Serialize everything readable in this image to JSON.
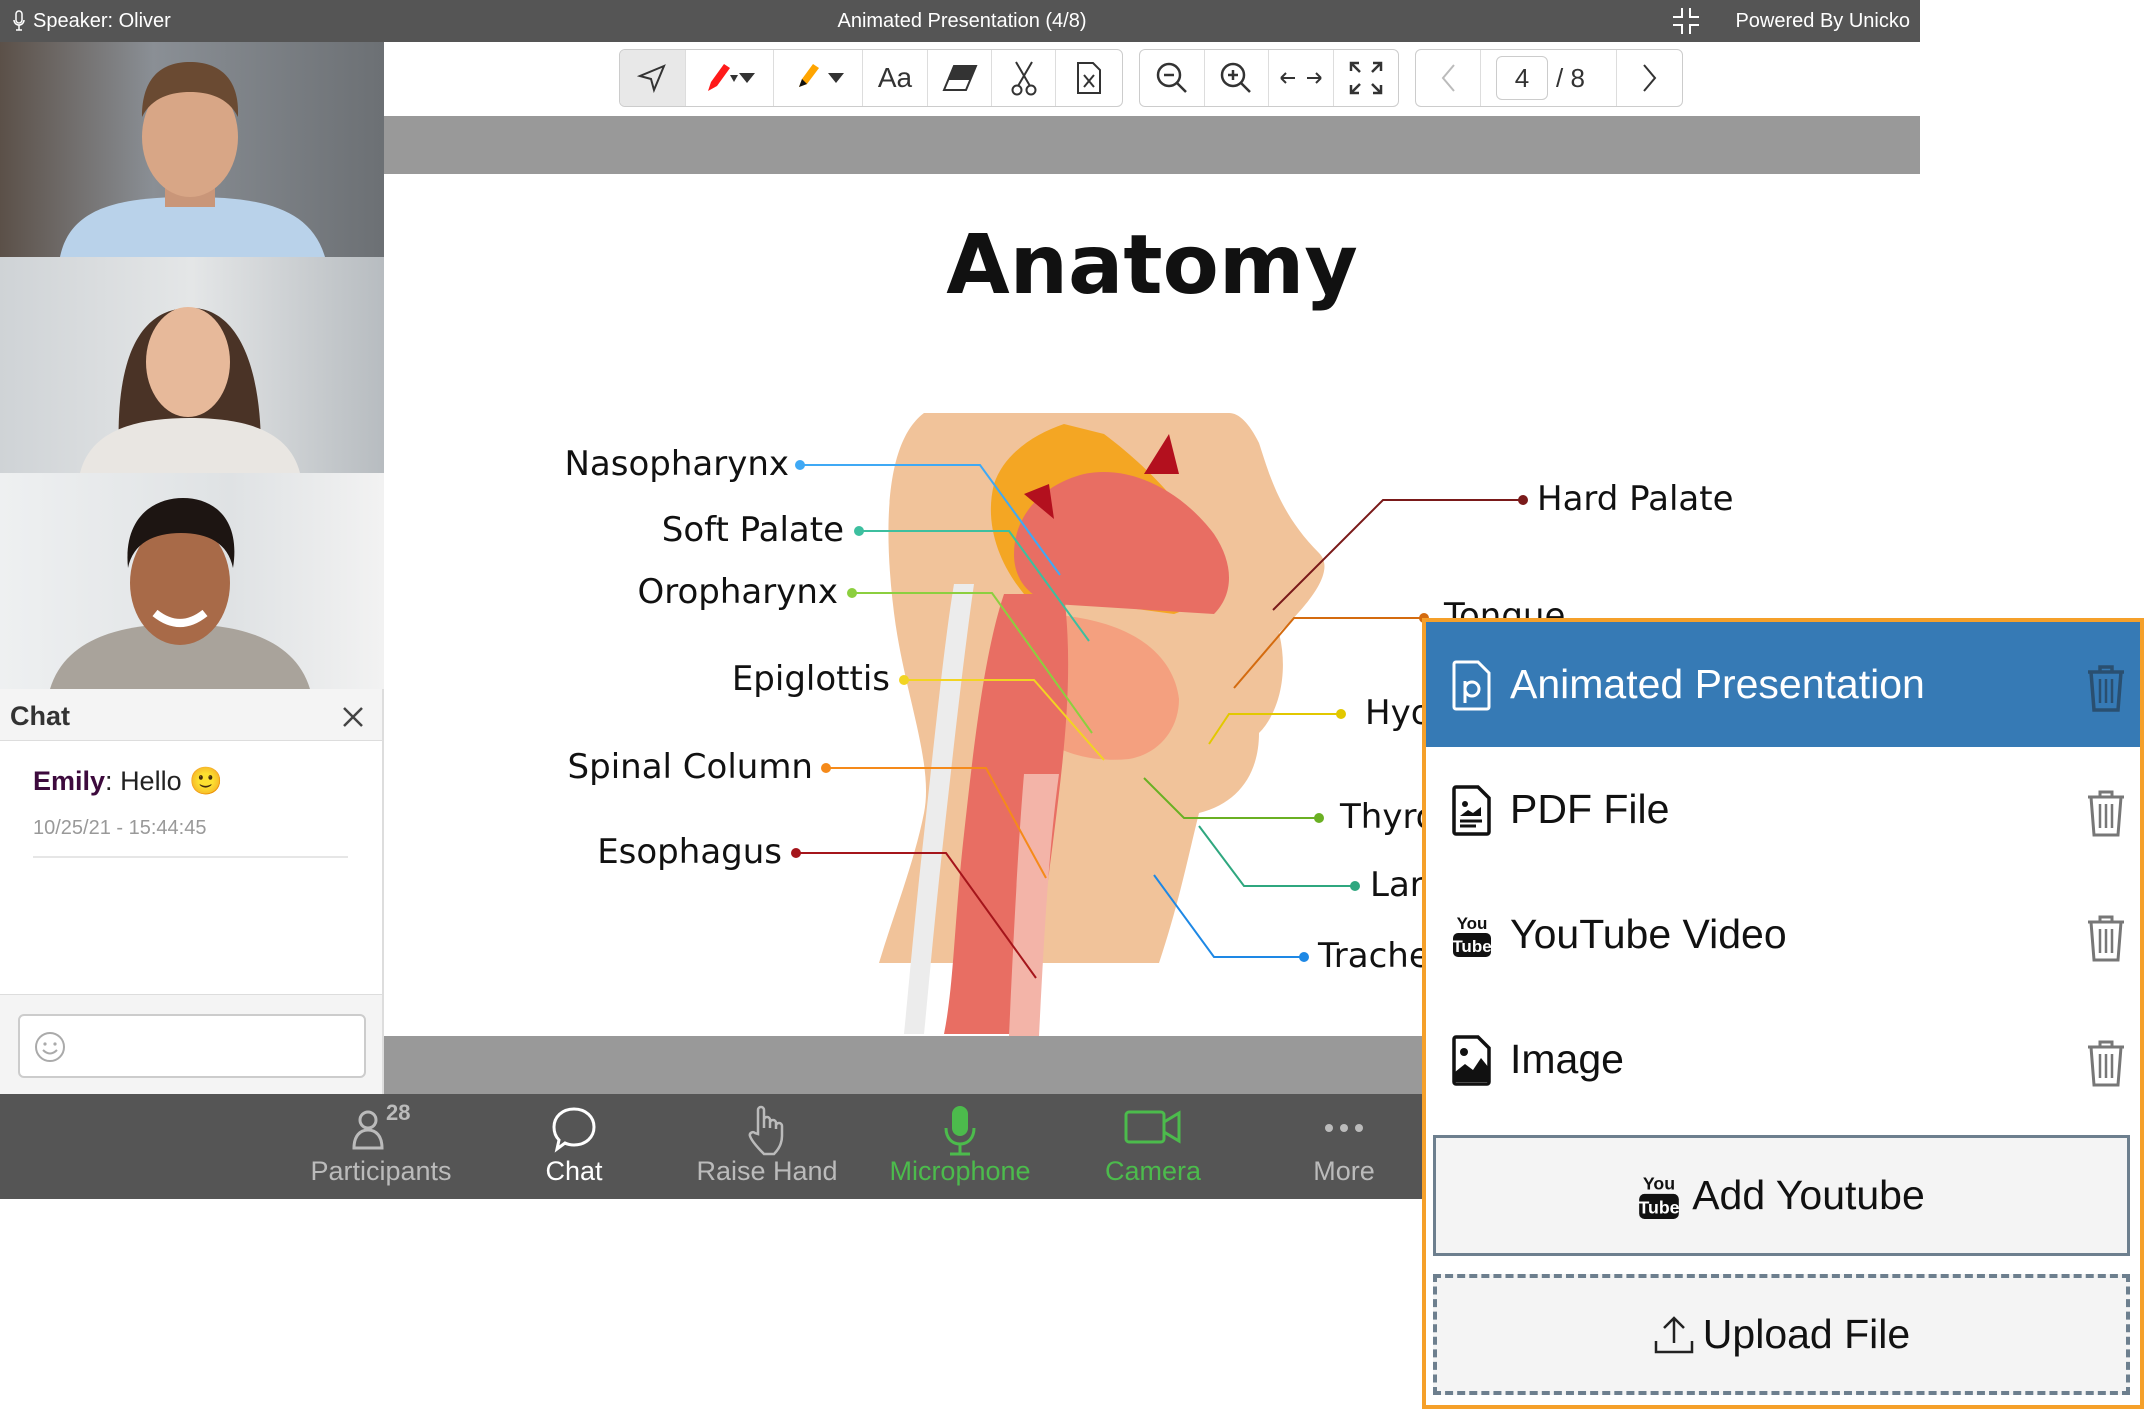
{
  "topbar": {
    "speaker": "Speaker: Oliver",
    "title": "Animated Presentation (4/8)",
    "powered": "Powered By Unicko"
  },
  "toolbar": {
    "page_current": "4",
    "page_total": "/ 8",
    "text_tool": "Aa",
    "pen_color": "#ff1a1a",
    "highlighter_color": "#ffa500"
  },
  "chat": {
    "title": "Chat",
    "messages": [
      {
        "author": "Emily",
        "separator": ": ",
        "text": "Hello",
        "emoji": "🙂",
        "timestamp": "10/25/21 - 15:44:45"
      }
    ],
    "input_placeholder": ""
  },
  "slide": {
    "title": "Anatomy",
    "labels_left": [
      "Nasopharynx",
      "Soft Palate",
      "Oropharynx",
      "Epiglottis",
      "Spinal Column",
      "Esophagus"
    ],
    "labels_right": [
      "Hard Palate",
      "Tongue",
      "Hyoid",
      "Thyroid",
      "Larynx",
      "Trachea"
    ]
  },
  "bottombar": {
    "participants_count": "28",
    "items": [
      "Participants",
      "Chat",
      "Raise Hand",
      "Microphone",
      "Camera",
      "More"
    ],
    "active_color": "#4cbb4c"
  },
  "panel": {
    "items": [
      {
        "label": "Animated Presentation",
        "icon": "presentation-file-icon",
        "selected": true
      },
      {
        "label": "PDF File",
        "icon": "pdf-file-icon"
      },
      {
        "label": "YouTube Video",
        "icon": "youtube-icon"
      },
      {
        "label": "Image",
        "icon": "image-file-icon"
      }
    ],
    "add_youtube": "Add Youtube",
    "upload_file": "Upload File",
    "accent": "#367ab5",
    "border": "#f5a02a"
  }
}
